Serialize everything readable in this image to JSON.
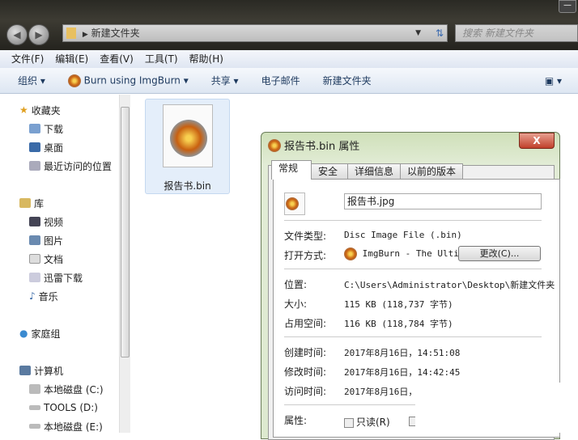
{
  "explorer": {
    "address": "新建文件夹",
    "search_placeholder": "搜索 新建文件夹",
    "menu": [
      "文件(F)",
      "编辑(E)",
      "查看(V)",
      "工具(T)",
      "帮助(H)"
    ],
    "toolbar": {
      "organize": "组织 ▾",
      "burn": "Burn using ImgBurn ▾",
      "share": "共享 ▾",
      "email": "电子邮件",
      "new_folder": "新建文件夹"
    },
    "sidebar": [
      "收藏夹",
      "下载",
      "桌面",
      "最近访问的位置",
      "库",
      "视频",
      "图片",
      "文档",
      "迅雷下载",
      "音乐",
      "家庭组",
      "计算机",
      "本地磁盘 (C:)",
      "TOOLS (D:)",
      "本地磁盘 (E:)"
    ],
    "file": {
      "name": "报告书.bin"
    }
  },
  "dialog": {
    "title": "报告书.bin 属性",
    "close": "X",
    "tabs": [
      "常规",
      "安全",
      "详细信息",
      "以前的版本"
    ],
    "filename": "报告书.jpg",
    "labels": {
      "type": "文件类型:",
      "open": "打开方式:",
      "location": "位置:",
      "size": "大小:",
      "disk": "占用空间:",
      "created": "创建时间:",
      "modified": "修改时间:",
      "accessed": "访问时间:",
      "attrs": "属性:"
    },
    "values": {
      "type": "Disc Image File (.bin)",
      "open": "ImgBurn - The Ultin",
      "location": "C:\\Users\\Administrator\\Desktop\\新建文件夹",
      "size": "115 KB (118,737 字节)",
      "disk": "116 KB (118,784 字节)",
      "created": "2017年8月16日，14:51:08",
      "modified": "2017年8月16日，14:42:45",
      "accessed": "2017年8月16日，:"
    },
    "change_button": "更改(C)...",
    "readonly": "只读(R)"
  }
}
